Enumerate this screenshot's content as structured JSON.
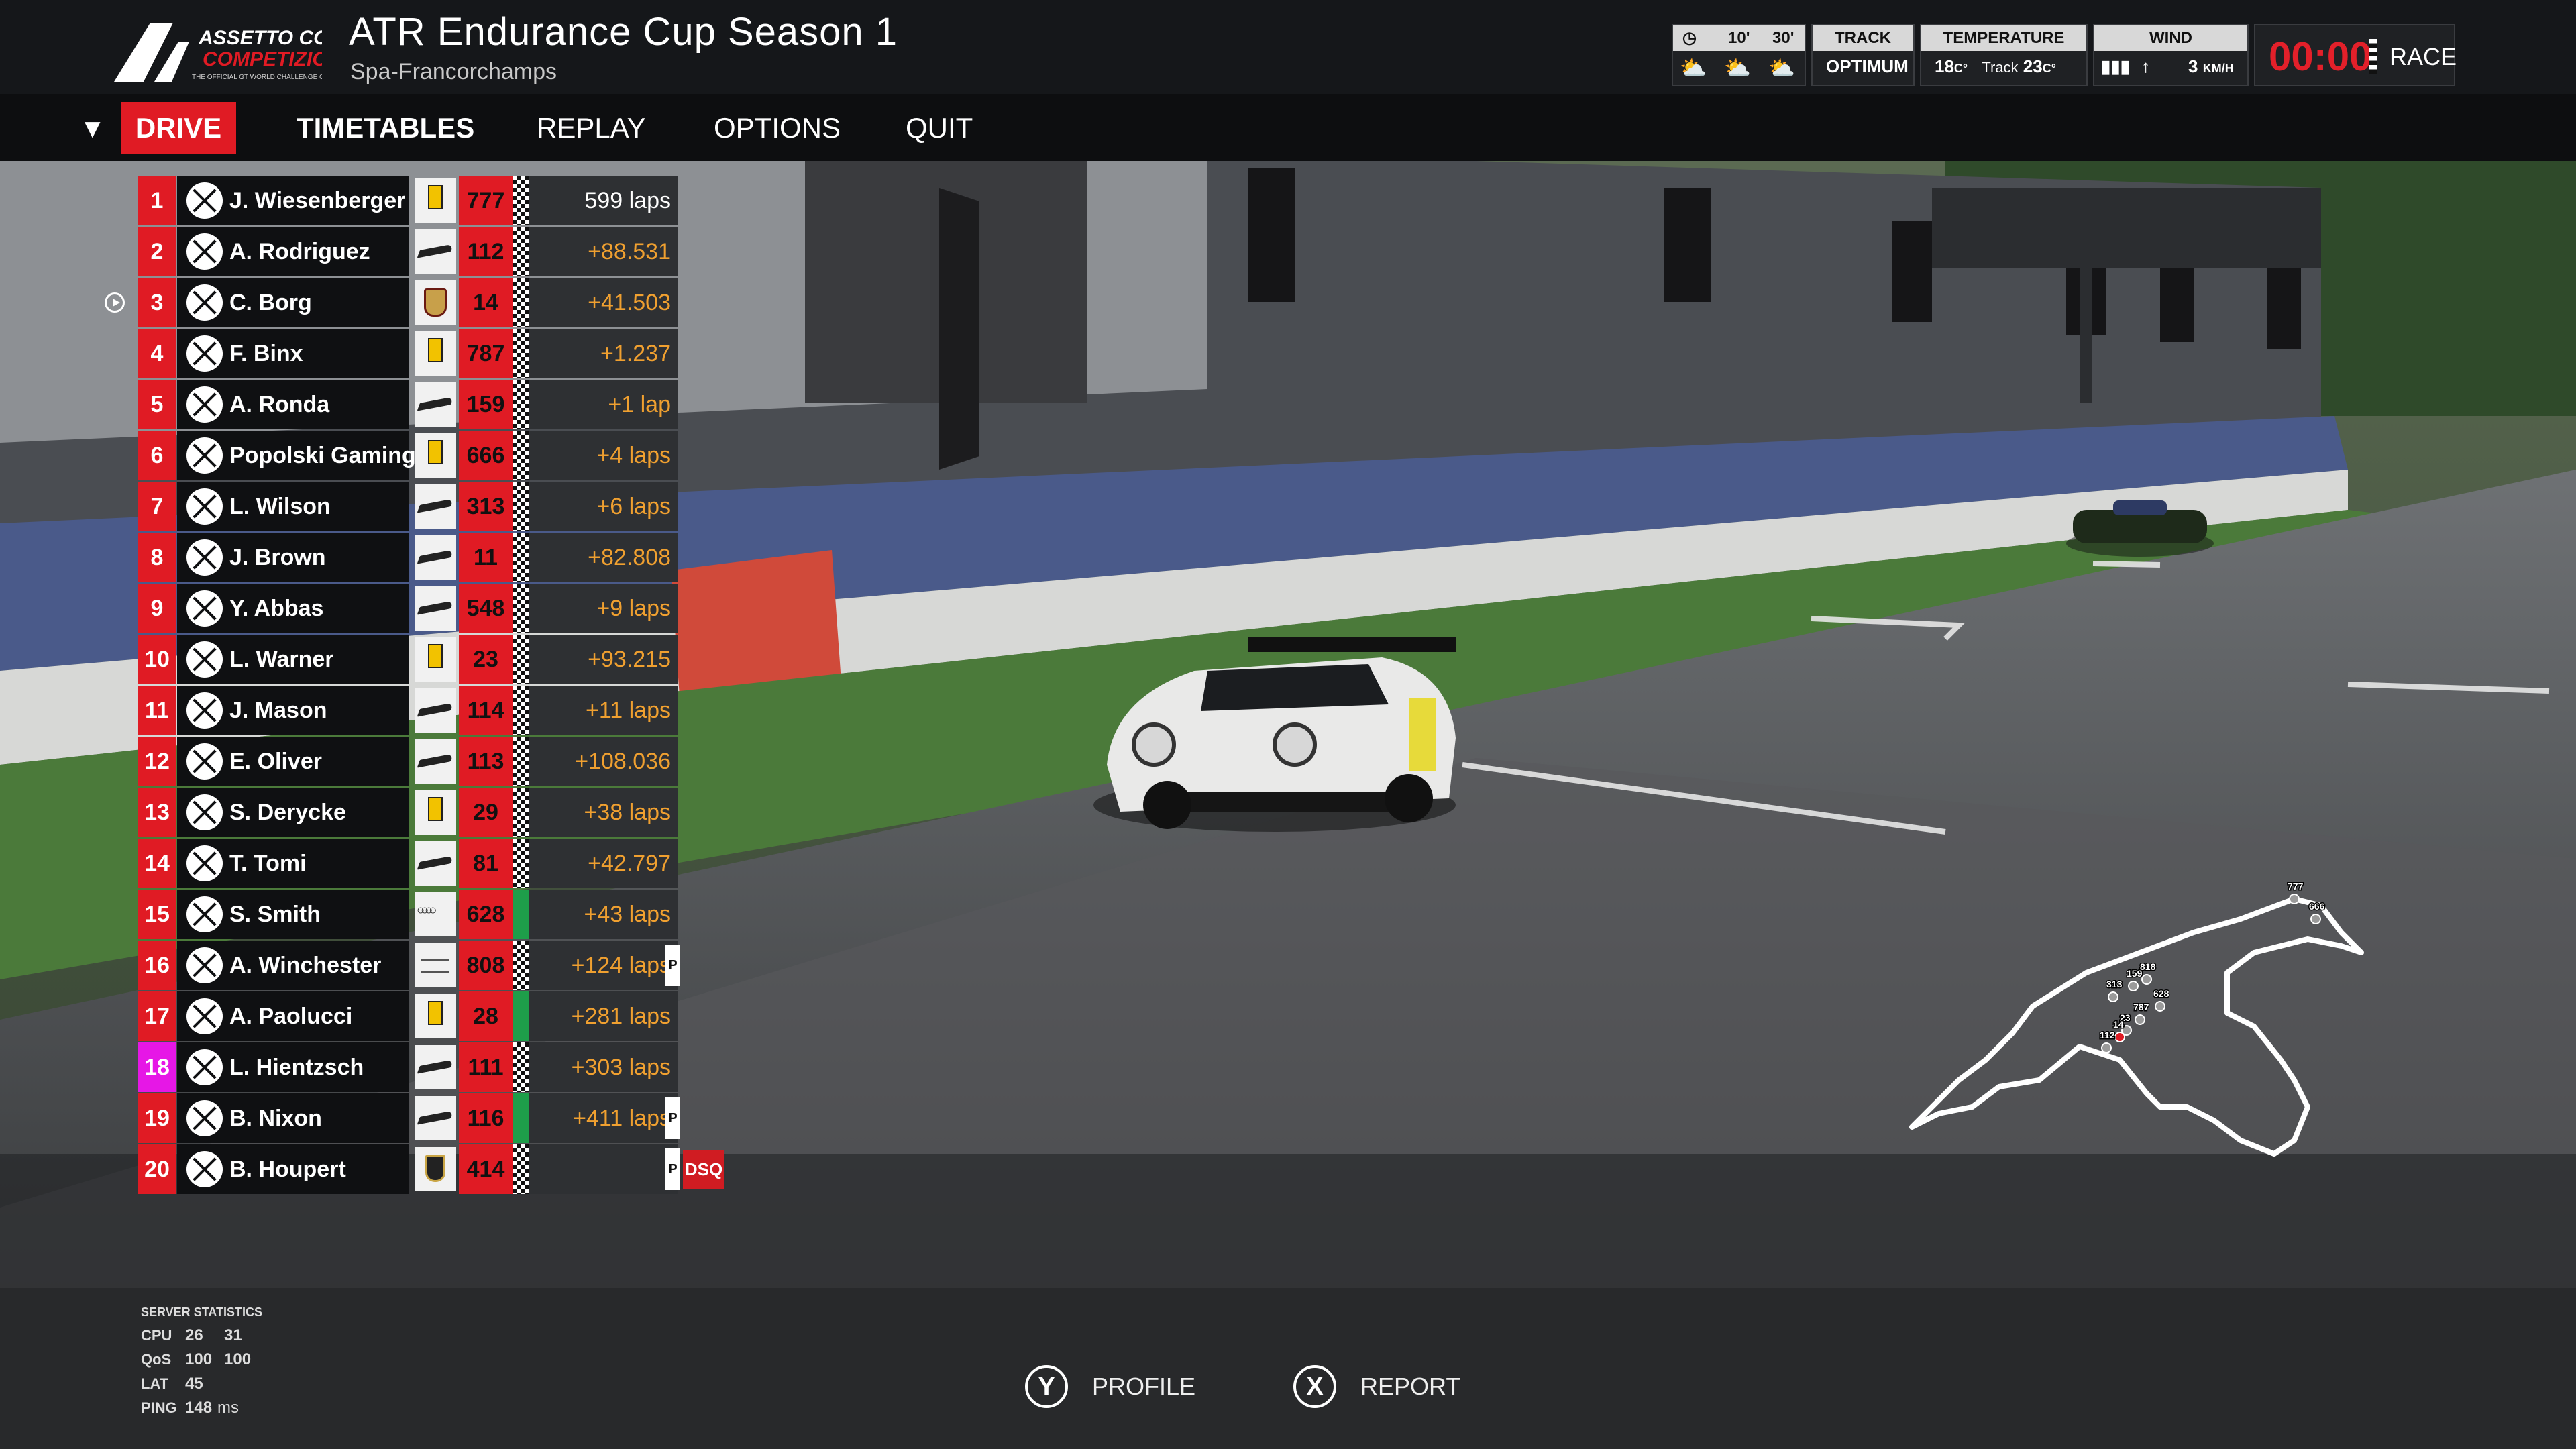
{
  "header": {
    "event_title": "ATR Endurance Cup Season 1",
    "track": "Spa-Francorchamps",
    "logo": {
      "line1": "ASSETTO CORSA",
      "line2": "COMPETIZIONE",
      "tagline": "THE OFFICIAL GT WORLD CHALLENGE GAME"
    },
    "forecast": {
      "times": [
        "10'",
        "30'"
      ],
      "icons": [
        "sun-cloud-icon",
        "sun-cloud-icon",
        "sun-cloud-icon"
      ]
    },
    "track_state": {
      "label": "TRACK",
      "value": "OPTIMUM"
    },
    "temperature": {
      "label": "TEMPERATURE",
      "air": "18",
      "track_label": "Track",
      "track": "23",
      "unit": "C°"
    },
    "wind": {
      "label": "WIND",
      "speed": "3",
      "unit": "KM/H"
    },
    "race_clock": {
      "time": "00:00",
      "session": "RACE"
    }
  },
  "nav": {
    "items": [
      "DRIVE",
      "TIMETABLES",
      "REPLAY",
      "OPTIONS",
      "QUIT"
    ],
    "active": "DRIVE"
  },
  "standings": [
    {
      "pos": "1",
      "driver": "J. Wiesenberger",
      "brand": "fer",
      "num": "777",
      "gap": "599 laps",
      "flag": "checker"
    },
    {
      "pos": "2",
      "driver": "A. Rodriguez",
      "brand": "mcl",
      "num": "112",
      "gap": "+88.531",
      "flag": "checker"
    },
    {
      "pos": "3",
      "driver": "C. Borg",
      "brand": "por",
      "num": "14",
      "gap": "+41.503",
      "flag": "checker",
      "camera": true
    },
    {
      "pos": "4",
      "driver": "F. Binx",
      "brand": "fer",
      "num": "787",
      "gap": "+1.237",
      "flag": "checker"
    },
    {
      "pos": "5",
      "driver": "A. Ronda",
      "brand": "mcl",
      "num": "159",
      "gap": "+1 lap",
      "flag": "checker"
    },
    {
      "pos": "6",
      "driver": "Popolski Gaming",
      "brand": "fer",
      "num": "666",
      "gap": "+4 laps",
      "flag": "checker"
    },
    {
      "pos": "7",
      "driver": "L. Wilson",
      "brand": "mcl",
      "num": "313",
      "gap": "+6 laps",
      "flag": "checker"
    },
    {
      "pos": "8",
      "driver": "J. Brown",
      "brand": "mcl",
      "num": "11",
      "gap": "+82.808",
      "flag": "checker"
    },
    {
      "pos": "9",
      "driver": "Y. Abbas",
      "brand": "mcl",
      "num": "548",
      "gap": "+9 laps",
      "flag": "checker"
    },
    {
      "pos": "10",
      "driver": "L. Warner",
      "brand": "fer",
      "num": "23",
      "gap": "+93.215",
      "flag": "checker"
    },
    {
      "pos": "11",
      "driver": "J. Mason",
      "brand": "mcl",
      "num": "114",
      "gap": "+11 laps",
      "flag": "checker"
    },
    {
      "pos": "12",
      "driver": "E. Oliver",
      "brand": "mcl",
      "num": "113",
      "gap": "+108.036",
      "flag": "checker"
    },
    {
      "pos": "13",
      "driver": "S. Derycke",
      "brand": "fer",
      "num": "29",
      "gap": "+38 laps",
      "flag": "checker"
    },
    {
      "pos": "14",
      "driver": "T. Tomi",
      "brand": "mcl",
      "num": "81",
      "gap": "+42.797",
      "flag": "checker"
    },
    {
      "pos": "15",
      "driver": "S. Smith",
      "brand": "aud",
      "num": "628",
      "gap": "+43 laps",
      "flag": "green"
    },
    {
      "pos": "16",
      "driver": "A. Winchester",
      "brand": "ben",
      "num": "808",
      "gap": "+124 laps",
      "flag": "checker",
      "pit": "P"
    },
    {
      "pos": "17",
      "driver": "A. Paolucci",
      "brand": "fer",
      "num": "28",
      "gap": "+281 laps",
      "flag": "green"
    },
    {
      "pos": "18",
      "driver": "L. Hientzsch",
      "brand": "mcl",
      "num": "111",
      "gap": "+303 laps",
      "flag": "checker",
      "highlight": true
    },
    {
      "pos": "19",
      "driver": "B. Nixon",
      "brand": "mcl",
      "num": "116",
      "gap": "+411 laps",
      "flag": "green",
      "pit": "P"
    },
    {
      "pos": "20",
      "driver": "B. Houpert",
      "brand": "lam",
      "num": "414",
      "gap": "",
      "flag": "checker",
      "pit": "P",
      "status": "DSQ"
    }
  ],
  "minimap": {
    "labels": [
      "777",
      "666",
      "818",
      "159",
      "313",
      "628",
      "787",
      "23",
      "14",
      "112"
    ]
  },
  "server_stats": {
    "title": "SERVER STATISTICS",
    "cpu": {
      "label": "CPU",
      "a": "26",
      "b": "31"
    },
    "qos": {
      "label": "QoS",
      "a": "100",
      "b": "100"
    },
    "lat": {
      "label": "LAT",
      "a": "45"
    },
    "ping": {
      "label": "PING",
      "a": "148",
      "unit": "ms"
    }
  },
  "bottom_buttons": [
    {
      "key": "Y",
      "label": "PROFILE"
    },
    {
      "key": "X",
      "label": "REPORT"
    }
  ],
  "colors": {
    "accent": "#e01b24",
    "highlight": "#e617e6",
    "gap": "#f0a030",
    "green_flag": "#1e9e4a"
  }
}
